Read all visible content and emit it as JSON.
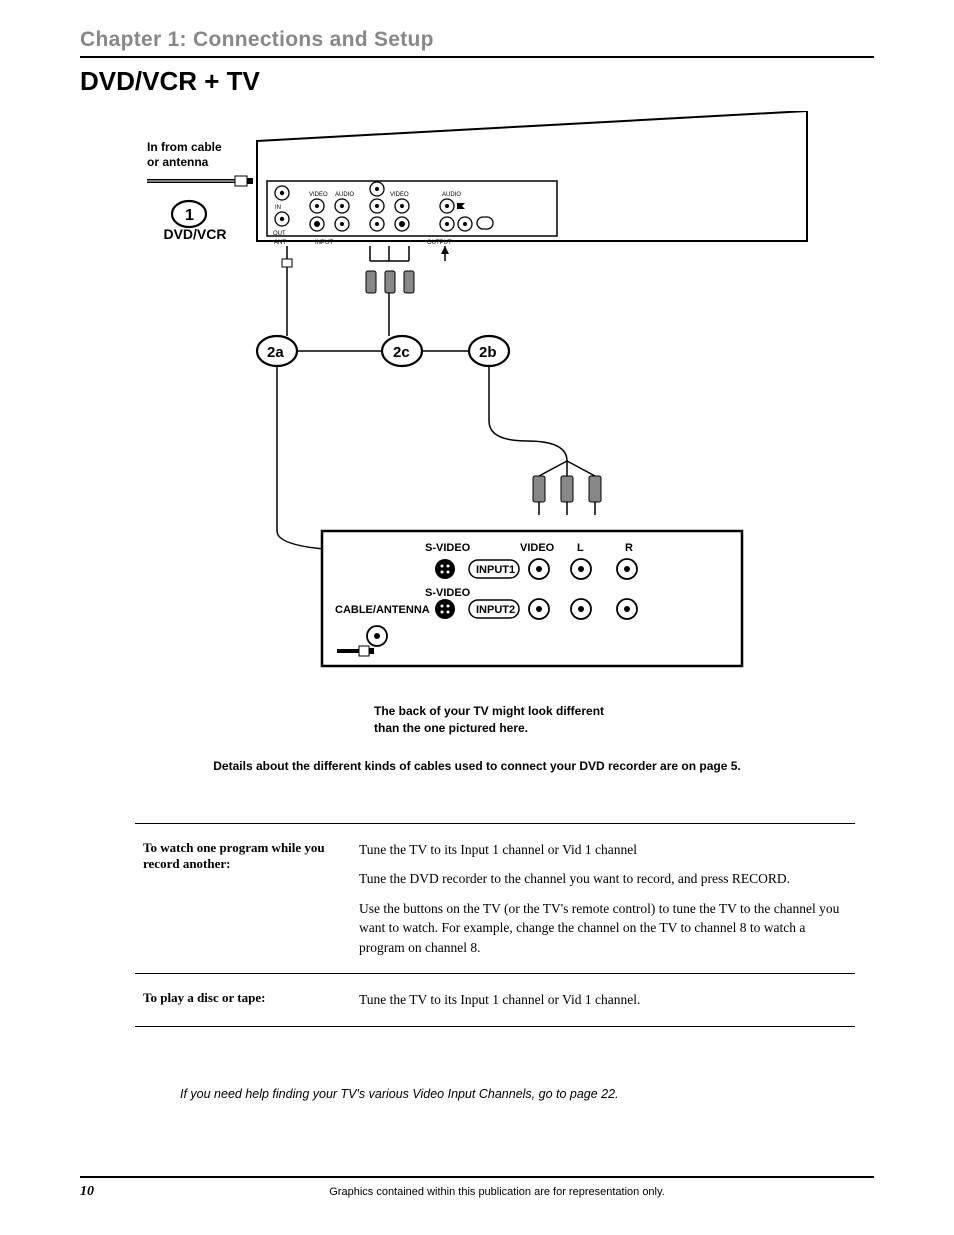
{
  "chapter_title": "Chapter 1: Connections and Setup",
  "section_title": "DVD/VCR + TV",
  "diagram": {
    "in_label_l1": "In from cable",
    "in_label_l2": "or antenna",
    "step1": "1",
    "dvdvcr": "DVD/VCR",
    "step2a": "2a",
    "step2b": "2b",
    "step2c": "2c",
    "ant": "ANT",
    "input_small": "INPUT",
    "output_small": "OUTPUT",
    "video": "VIDEO",
    "audio": "AUDIO",
    "in_small": "IN",
    "out_small": "OUT",
    "svideo": "S-VIDEO",
    "videoU": "VIDEO",
    "L": "L",
    "R": "R",
    "input1": "INPUT1",
    "input2": "INPUT2",
    "cable_antenna": "CABLE/ANTENNA"
  },
  "caption_l1": "The back of your TV might look different",
  "caption_l2": "than the one pictured here.",
  "details_line": "Details about the different kinds of cables used to connect your DVD recorder are on page 5.",
  "instructions": {
    "row1_head_l1": "To watch one program while you",
    "row1_head_l2": "record another:",
    "row1_body_p1": "Tune the TV to its Input 1 channel or Vid 1 channel",
    "row1_body_p2": "Tune the DVD recorder to the channel you want to record, and press RECORD.",
    "row1_body_p3": "Use the buttons on the TV (or the TV's remote control) to tune the TV to the channel you want to watch. For example, change the channel on the TV to channel 8 to watch a program on channel 8.",
    "row2_head": "To play a disc or tape:",
    "row2_body": "Tune the TV to its Input 1 channel or Vid 1 channel."
  },
  "help_line": "If you need help finding your TV's various Video Input Channels, go to page 22.",
  "footer": {
    "page_number": "10",
    "text": "Graphics contained within this publication are for representation only."
  }
}
